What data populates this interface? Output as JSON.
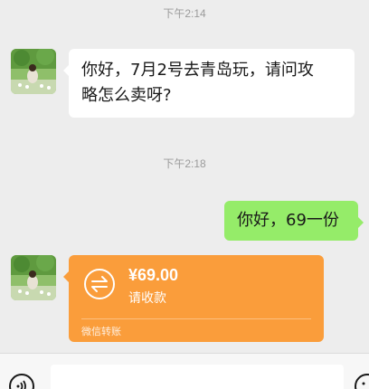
{
  "messages": {
    "time_1": "下午2:14",
    "msg_1_line_1": "你好，7月2号去青岛玩，请问攻",
    "msg_1_line_2": "略怎么卖呀?",
    "time_2": "下午2:18",
    "msg_2": "你好，69一份"
  },
  "transfer": {
    "amount": "¥69.00",
    "status": "请收款",
    "footer": "微信转账"
  },
  "input_bar": {
    "placeholder": ""
  },
  "icons": {
    "voice": "voice-icon",
    "emoji": "emoji-icon",
    "transfer": "transfer-arrows-icon",
    "avatar": "avatar-landscape-image"
  },
  "colors": {
    "background": "#ededed",
    "incoming_bubble": "#ffffff",
    "outgoing_bubble": "#95ec69",
    "transfer_card": "#fa9d3b"
  }
}
